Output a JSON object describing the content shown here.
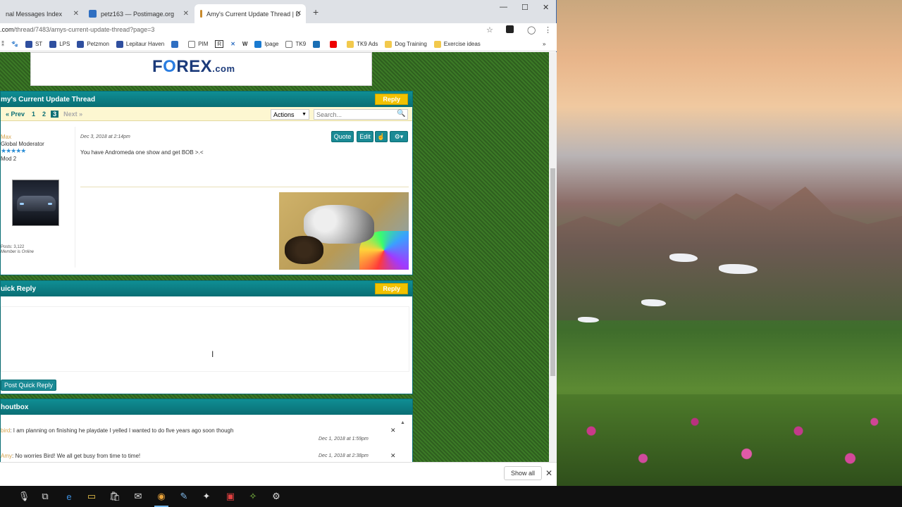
{
  "browser": {
    "tabs": [
      {
        "label": "nal Messages Index"
      },
      {
        "label": "petz163 — Postimage.org"
      },
      {
        "label": "Amy's Current Update Thread | D"
      }
    ],
    "url_host": ".com",
    "url_path": "/thread/7483/amys-current-update-thread?page=3",
    "bookmarks": [
      "ST",
      "LPS",
      "Petzmon",
      "Lepitaur Haven",
      "PIM",
      "Ipage",
      "TK9",
      "TK9 Ads",
      "Dog Training",
      "Exercise ideas"
    ],
    "more_bookmarks": "»"
  },
  "ad": {
    "brand_f": "F",
    "brand_o": "O",
    "brand_rest": "REX",
    "brand_tld": ".com"
  },
  "thread": {
    "title": "my's Current Update Thread",
    "reply_label": "Reply",
    "pagination": {
      "prev": "« Prev",
      "p1": "1",
      "p2": "2",
      "p3": "3",
      "next": "Next »"
    },
    "actions_label": "Actions",
    "search_placeholder": "Search..."
  },
  "post": {
    "username": "Max",
    "user_title": "Global Moderator",
    "stars": "★★★★★",
    "user_group": "Mod 2",
    "posts": "Posts: 3,122",
    "online": "Member is Online",
    "date": "Dec 3, 2018 at 2:14pm",
    "quote_label": "Quote",
    "edit_label": "Edit",
    "text": "You have Andromeda one show and get BOB >.<"
  },
  "quick_reply": {
    "title": "uick Reply",
    "reply_label": "Reply",
    "post_label": "Post Quick Reply"
  },
  "shoutbox": {
    "title": "houtbox",
    "shouts": [
      {
        "who": "bird",
        "text": ": I am planning on finishing he playdate I yelled I wanted to do five years ago soon though",
        "date": "Dec 1, 2018 at 1:59pm"
      },
      {
        "who": "Amy",
        "text": ": No worries Bird! We all get busy from time to time!",
        "date": "Dec 1, 2018 at 2:38pm"
      }
    ]
  },
  "downloads": {
    "show_all": "Show all"
  },
  "colors": {
    "accent": "#0a6e74",
    "reply": "#f2c200",
    "username": "#d4a24c"
  }
}
